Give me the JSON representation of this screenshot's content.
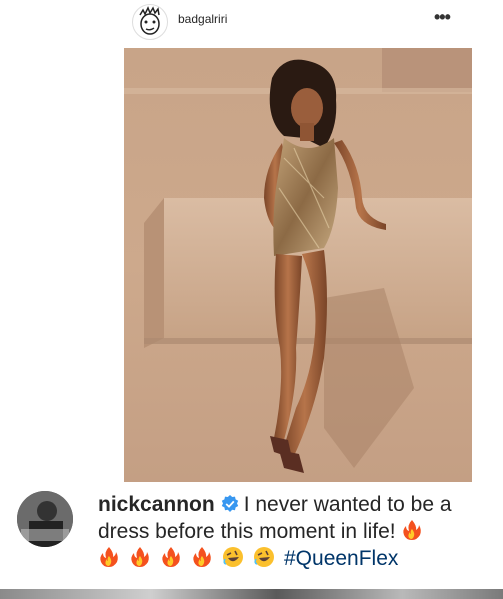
{
  "post": {
    "author": "badgalriri",
    "more_label": "•••"
  },
  "comment": {
    "user": "nickcannon",
    "text_line": "I never wanted to be a dress before this moment in life!",
    "emojis": [
      "fire-emoji",
      "fire-emoji",
      "fire-emoji",
      "fire-emoji",
      "fire-emoji",
      "rofl-emoji",
      "rofl-emoji"
    ],
    "hashtag": "#QueenFlex"
  },
  "colors": {
    "verified": "#3897f0",
    "hashtag": "#003569"
  }
}
